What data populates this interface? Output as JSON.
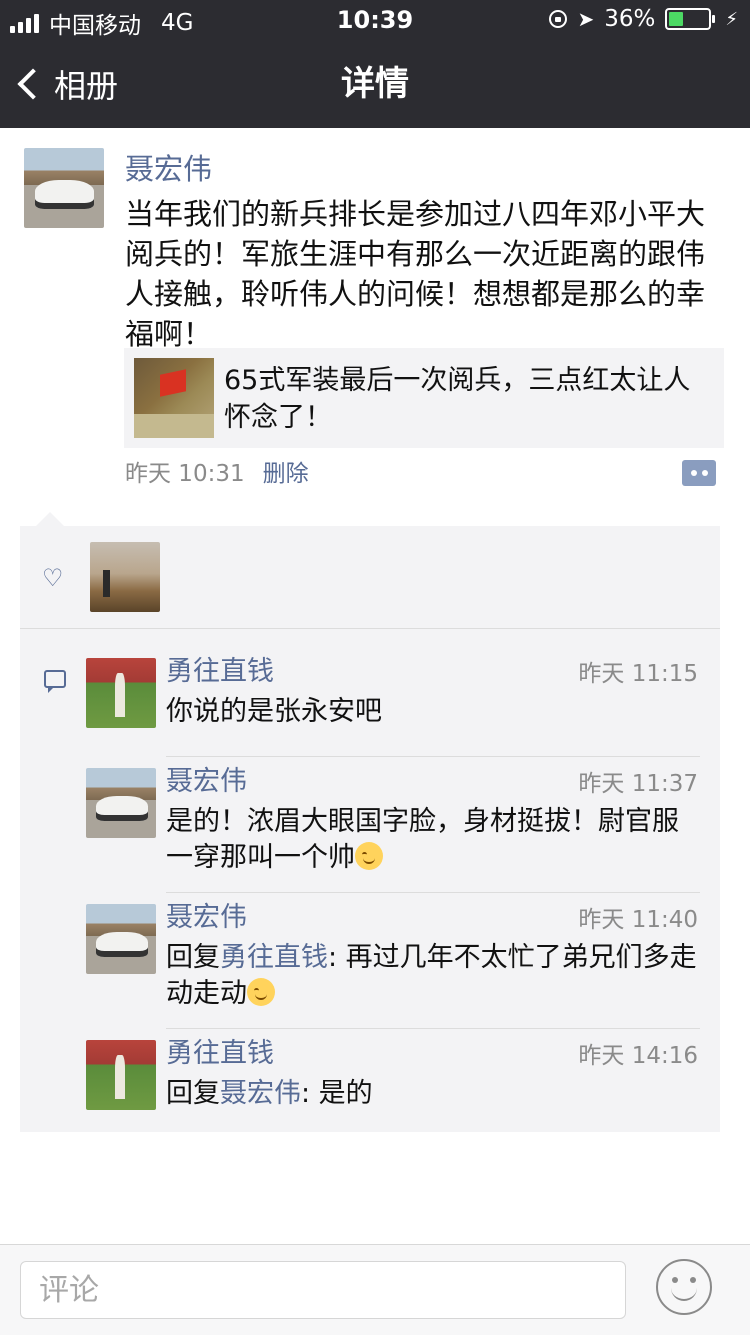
{
  "status_bar": {
    "carrier": "中国移动",
    "network": "4G",
    "time": "10:39",
    "battery": "36%",
    "battery_level": 0.36,
    "icons": [
      "signal-icon",
      "orientation-lock-icon",
      "location-icon",
      "battery-icon",
      "charging-icon"
    ]
  },
  "nav": {
    "back_label": "相册",
    "title": "详情"
  },
  "post": {
    "author": "聂宏伟",
    "text": "当年我们的新兵排长是参加过八四年邓小平大阅兵的！军旅生涯中有那么一次近距离的跟伟人接触，聆听伟人的问候！想想都是那么的幸福啊！",
    "link_title": "65式军装最后一次阅兵，三点红太让人怀念了！",
    "time": "昨天 10:31",
    "delete_label": "删除"
  },
  "comments": [
    {
      "name": "勇往直钱",
      "time": "昨天 11:15",
      "text": "你说的是张永安吧",
      "reply_to": "",
      "emoji": false
    },
    {
      "name": "聂宏伟",
      "time": "昨天 11:37",
      "text": "是的！浓眉大眼国字脸，身材挺拔！尉官服一穿那叫一个帅",
      "reply_to": "",
      "emoji": true
    },
    {
      "name": "聂宏伟",
      "time": "昨天 11:40",
      "reply_prefix": "回复",
      "reply_to": "勇往直钱",
      "text": ": 再过几年不太忙了弟兄们多走动走动",
      "emoji": true
    },
    {
      "name": "勇往直钱",
      "time": "昨天 14:16",
      "reply_prefix": "回复",
      "reply_to": "聂宏伟",
      "text": ": 是的",
      "emoji": false
    }
  ],
  "footer": {
    "comment_placeholder": "评论"
  },
  "colors": {
    "header_bg": "#2c2c31",
    "link_blue": "#576b95",
    "panel_bg": "#f3f3f5",
    "battery_green": "#4cd964"
  }
}
